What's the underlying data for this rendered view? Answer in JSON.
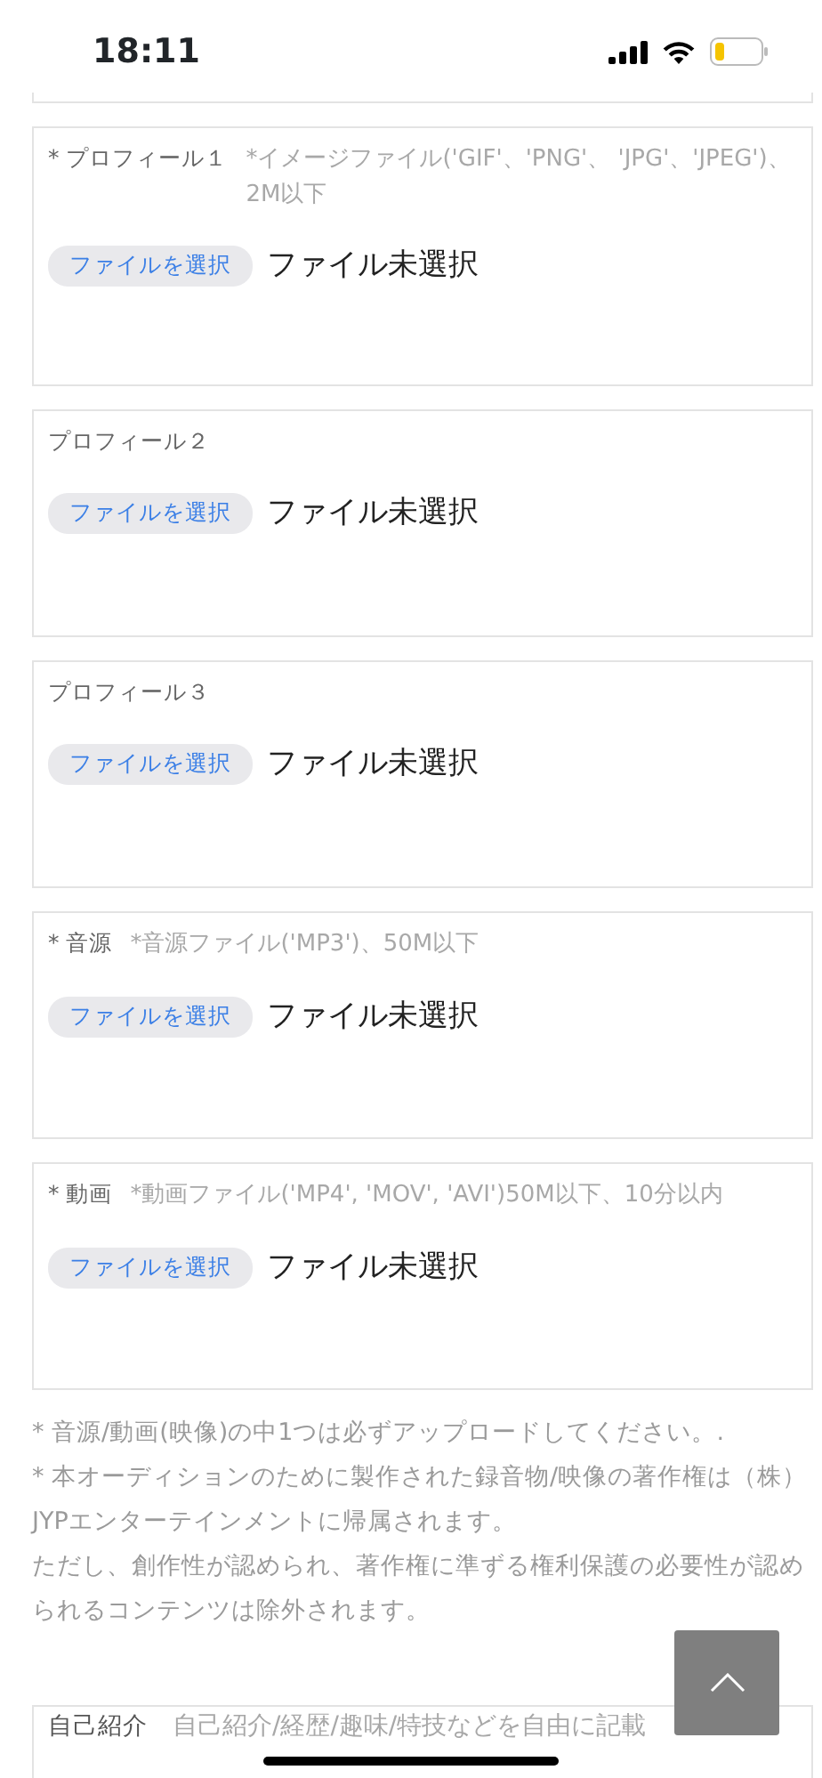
{
  "status_bar": {
    "time": "18:11"
  },
  "upload_fields": [
    {
      "label": "* プロフィール１",
      "hint": "*イメージファイル('GIF'、'PNG'、 'JPG'、'JPEG')、 2M以下",
      "button": "ファイルを選択",
      "status": "ファイル未選択"
    },
    {
      "label": "プロフィール２",
      "button": "ファイルを選択",
      "status": "ファイル未選択"
    },
    {
      "label": "プロフィール３",
      "button": "ファイルを選択",
      "status": "ファイル未選択"
    },
    {
      "label": "* 音源",
      "hint": "*音源ファイル('MP3')、50M以下",
      "button": "ファイルを選択",
      "status": "ファイル未選択"
    },
    {
      "label": "* 動画",
      "hint": "*動画ファイル('MP4', 'MOV', 'AVI')50M以下、10分以内",
      "button": "ファイルを選択",
      "status": "ファイル未選択"
    }
  ],
  "notes": [
    "* 音源/動画(映像)の中1つは必ずアップロードしてください。.",
    "* 本オーディションのために製作された録音物/映像の著作権は（株）JYPエンターテインメントに帰属されます。",
    "ただし、創作性が認められ、著作権に準ずる権利保護の必要性が認められるコンテンツは除外されます。"
  ],
  "self_intro": {
    "label": "自己紹介",
    "placeholder": "自己紹介/経歴/趣味/特技などを自由に記載"
  }
}
